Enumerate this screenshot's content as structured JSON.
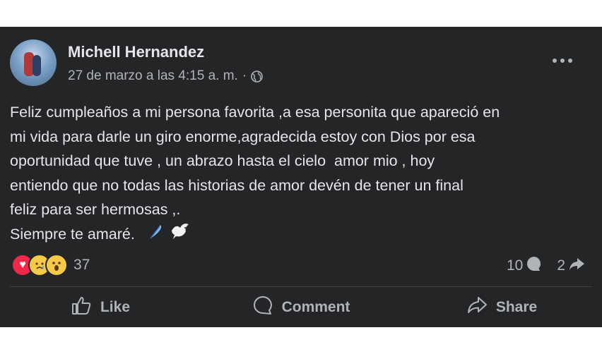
{
  "post": {
    "author": "Michell Hernandez",
    "timestamp": "27 de marzo a las 4:15 a. m.",
    "separator": "·",
    "privacy_icon": "globe-icon",
    "more_icon": "more-options-icon",
    "lines": [
      "Feliz cumpleaños a mi persona favorita ,a esa personita que apareció en",
      "mi vida para darle un giro enorme,agradecida estoy con Dios por esa",
      "oportunidad que tuve , un abrazo hasta el cielo  amor mio , hoy",
      "entiendo que no todas las historias de amor devén de tener un final",
      "feliz para ser hermosas ,.",
      "Siempre te amaré."
    ],
    "line_emojis": [
      "feather-icon",
      "dove-icon"
    ]
  },
  "engagement": {
    "reaction_icons": [
      "love-reaction-icon",
      "sad-reaction-icon",
      "wow-reaction-icon"
    ],
    "reaction_count": "37",
    "comment_count": "10",
    "share_count": "2"
  },
  "actions": {
    "like_label": "Like",
    "comment_label": "Comment",
    "share_label": "Share"
  },
  "colors": {
    "card_background": "#242526",
    "primary_text": "#e4e6eb",
    "secondary_text": "#b0b3b8",
    "love": "#f0284a",
    "reaction_yellow": "#f7c948"
  }
}
